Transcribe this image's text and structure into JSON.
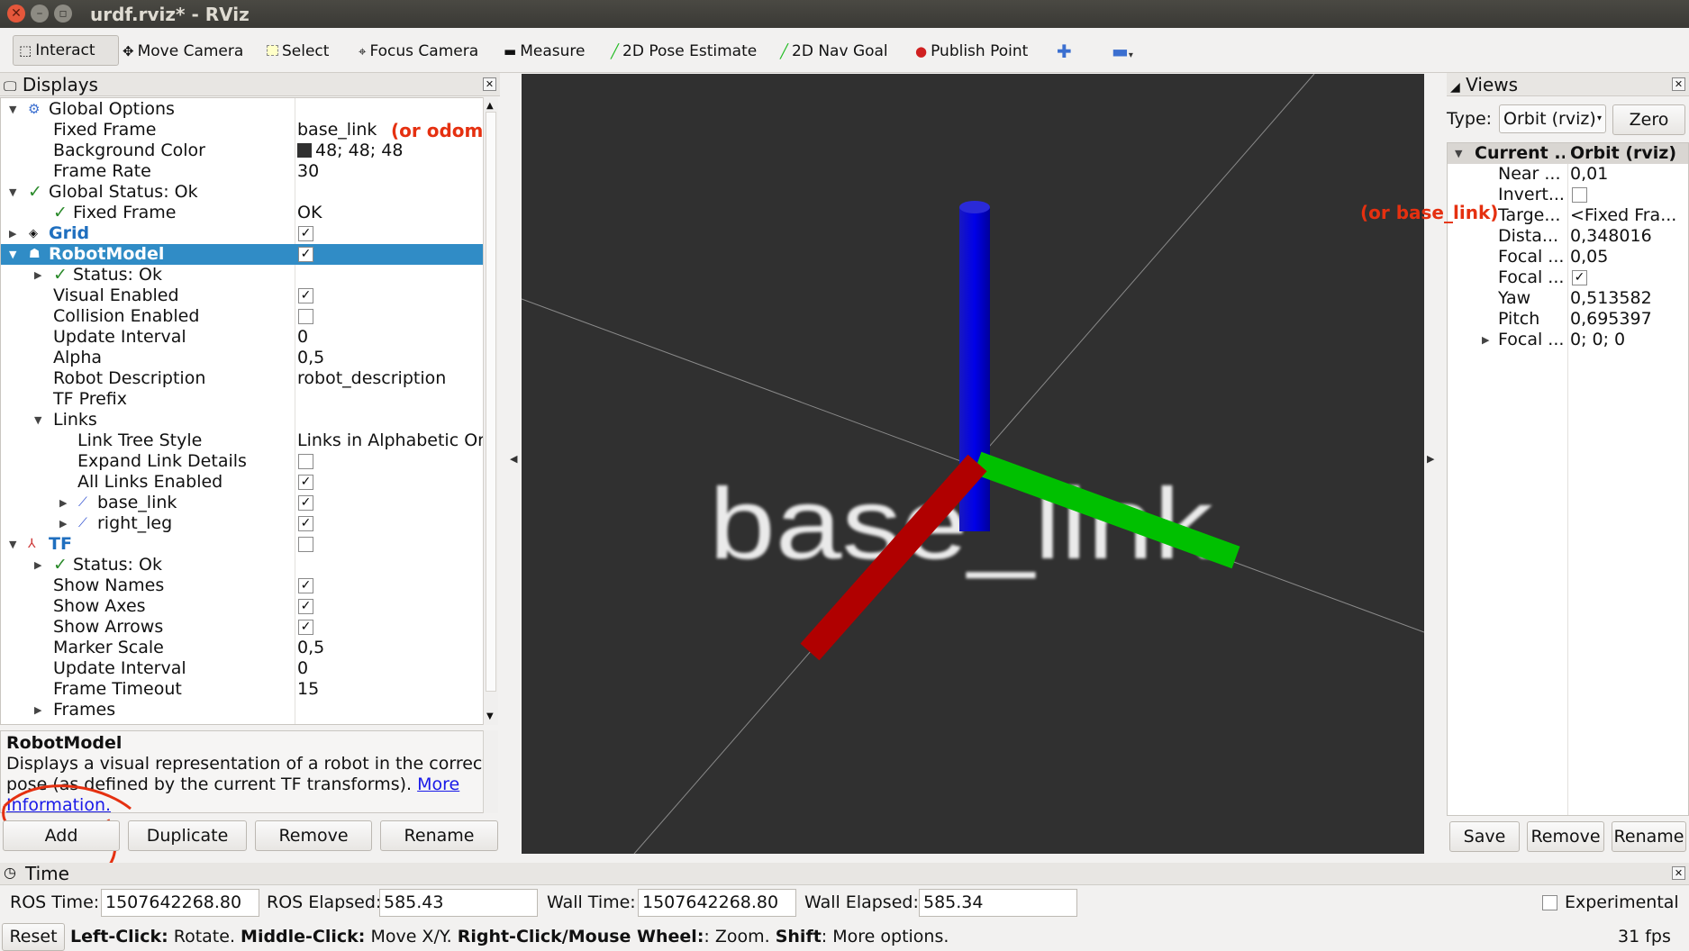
{
  "window": {
    "title": "urdf.rviz* - RViz"
  },
  "toolbar": {
    "tools": [
      "Interact",
      "Move Camera",
      "Select",
      "Focus Camera",
      "Measure",
      "2D Pose Estimate",
      "2D Nav Goal",
      "Publish Point"
    ]
  },
  "displays": {
    "title": "Displays",
    "rows": [
      {
        "name": "Global Options",
        "value": ""
      },
      {
        "name": "Fixed Frame",
        "value": "base_link"
      },
      {
        "name": "Background Color",
        "value": "48; 48; 48"
      },
      {
        "name": "Frame Rate",
        "value": "30"
      },
      {
        "name": "Global Status: Ok",
        "value": ""
      },
      {
        "name": "Fixed Frame",
        "value": "OK"
      },
      {
        "name": "Grid",
        "value": ""
      },
      {
        "name": "RobotModel",
        "value": ""
      },
      {
        "name": "Status: Ok",
        "value": ""
      },
      {
        "name": "Visual Enabled",
        "value": ""
      },
      {
        "name": "Collision Enabled",
        "value": ""
      },
      {
        "name": "Update Interval",
        "value": "0"
      },
      {
        "name": "Alpha",
        "value": "0,5"
      },
      {
        "name": "Robot Description",
        "value": "robot_description"
      },
      {
        "name": "TF Prefix",
        "value": ""
      },
      {
        "name": "Links",
        "value": ""
      },
      {
        "name": "Link Tree Style",
        "value": "Links in Alphabetic Or..."
      },
      {
        "name": "Expand Link Details",
        "value": ""
      },
      {
        "name": "All Links Enabled",
        "value": ""
      },
      {
        "name": "base_link",
        "value": ""
      },
      {
        "name": "right_leg",
        "value": ""
      },
      {
        "name": "TF",
        "value": ""
      },
      {
        "name": "Status: Ok",
        "value": ""
      },
      {
        "name": "Show Names",
        "value": ""
      },
      {
        "name": "Show Axes",
        "value": ""
      },
      {
        "name": "Show Arrows",
        "value": ""
      },
      {
        "name": "Marker Scale",
        "value": "0,5"
      },
      {
        "name": "Update Interval",
        "value": "0"
      },
      {
        "name": "Frame Timeout",
        "value": "15"
      },
      {
        "name": "Frames",
        "value": ""
      }
    ],
    "annotation_fixed_frame": "(or odom)",
    "description_title": "RobotModel",
    "description_text": "Displays a visual representation of a robot in the correct pose (as defined by the current TF transforms).",
    "description_link": "More Information.",
    "buttons": {
      "add": "Add",
      "duplicate": "Duplicate",
      "remove": "Remove",
      "rename": "Rename"
    }
  },
  "viewport": {
    "frame_label": "base_link",
    "background": "#303030"
  },
  "views": {
    "title": "Views",
    "type_label": "Type:",
    "type_value": "Orbit (rviz)",
    "zero_label": "Zero",
    "header_name": "Current ...",
    "header_value": "Orbit (rviz)",
    "annotation_target": "(or base_link)",
    "rows": [
      {
        "name": "Near ...",
        "value": "0,01"
      },
      {
        "name": "Invert...",
        "value": ""
      },
      {
        "name": "Targe...",
        "value": "<Fixed Fra..."
      },
      {
        "name": "Dista...",
        "value": "0,348016"
      },
      {
        "name": "Focal ...",
        "value": "0,05"
      },
      {
        "name": "Focal ...",
        "value": ""
      },
      {
        "name": "Yaw",
        "value": "0,513582"
      },
      {
        "name": "Pitch",
        "value": "0,695397"
      },
      {
        "name": "Focal ...",
        "value": "0; 0; 0"
      }
    ],
    "buttons": {
      "save": "Save",
      "remove": "Remove",
      "rename": "Rename"
    }
  },
  "time": {
    "title": "Time",
    "ros_time_label": "ROS Time:",
    "ros_time": "1507642268.80",
    "ros_elapsed_label": "ROS Elapsed:",
    "ros_elapsed": "585.43",
    "wall_time_label": "Wall Time:",
    "wall_time": "1507642268.80",
    "wall_elapsed_label": "Wall Elapsed:",
    "wall_elapsed": "585.34",
    "experimental_label": "Experimental",
    "reset_label": "Reset",
    "status_help": {
      "left_key": "Left-Click:",
      "left_txt": " Rotate. ",
      "mid_key": "Middle-Click:",
      "mid_txt": " Move X/Y. ",
      "right_key": "Right-Click/Mouse Wheel:",
      "right_txt": ": Zoom. ",
      "shift_key": "Shift",
      "shift_txt": ": More options."
    },
    "fps": "31 fps"
  },
  "colors": {
    "selection": "#308cc6",
    "annotation": "#e53010",
    "x_axis": "#c00000",
    "y_axis": "#00c000",
    "z_axis": "#0000c0"
  }
}
